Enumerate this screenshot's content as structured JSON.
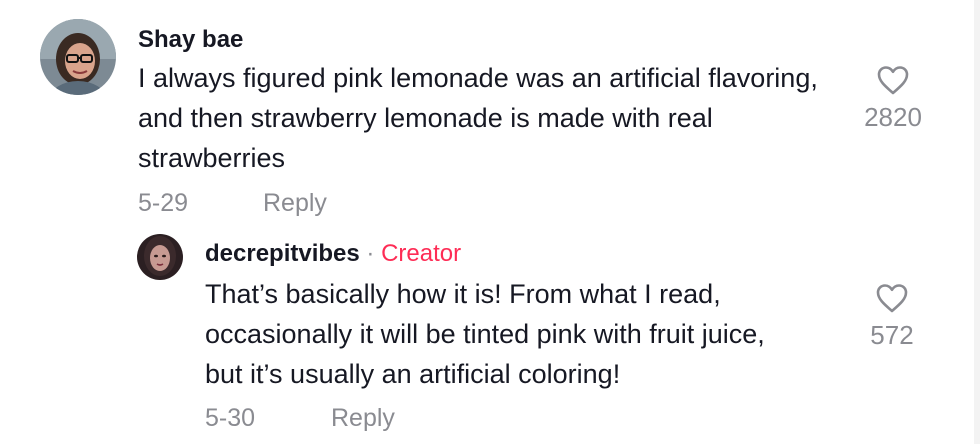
{
  "comments": [
    {
      "author": "Shay bae",
      "text": "I always figured pink lemonade was an artificial flavoring, and then strawberry lemonade is made with real strawberries",
      "date": "5-29",
      "reply_label": "Reply",
      "likes": "2820",
      "avatar_icon": "profile-photo"
    }
  ],
  "reply": {
    "author": "decrepitvibes",
    "separator": " · ",
    "badge": "Creator",
    "text": "That’s basically how it is! From what I read, occasionally it will be tinted pink with fruit juice, but it’s usually an artificial coloring!",
    "date": "5-30",
    "reply_label": "Reply",
    "likes": "572",
    "avatar_icon": "profile-photo"
  },
  "colors": {
    "creator_badge": "#fe2c55",
    "meta_text": "#8a8b91",
    "primary_text": "#161823"
  },
  "icons": {
    "like": "heart-outline-icon"
  }
}
